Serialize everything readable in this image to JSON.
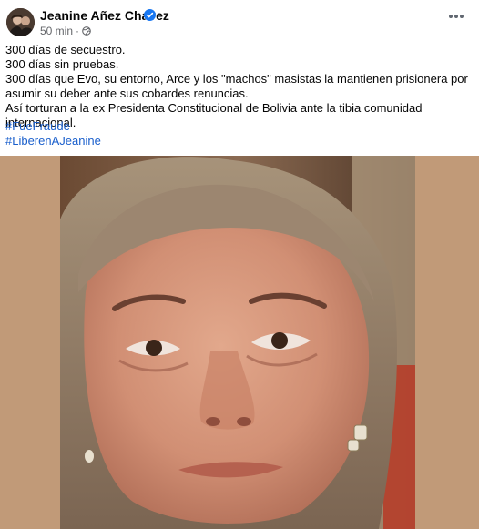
{
  "post": {
    "author": "Jeanine Añez Chavez",
    "time": "50 min",
    "separator": "·",
    "lines": [
      "300 días de secuestro.",
      "300 días sin pruebas.",
      "300 días que Evo, su entorno, Arce y los \"machos\" masistas la mantienen prisionera por asumir su deber ante sus cobardes renuncias.",
      "Así torturan a la ex Presidenta Constitucional de Bolivia ante la tibia comunidad internacional."
    ],
    "hashtags": [
      "#FueFraude",
      "#LiberenAJeanine"
    ]
  },
  "icons": {
    "verified": "verified-badge-icon",
    "audience": "globe-icon",
    "more": "more-options-icon"
  },
  "colors": {
    "link": "#1a5fcc",
    "verified": "#1877f2",
    "meta": "#65676b",
    "photo_background": "#c19a78"
  }
}
